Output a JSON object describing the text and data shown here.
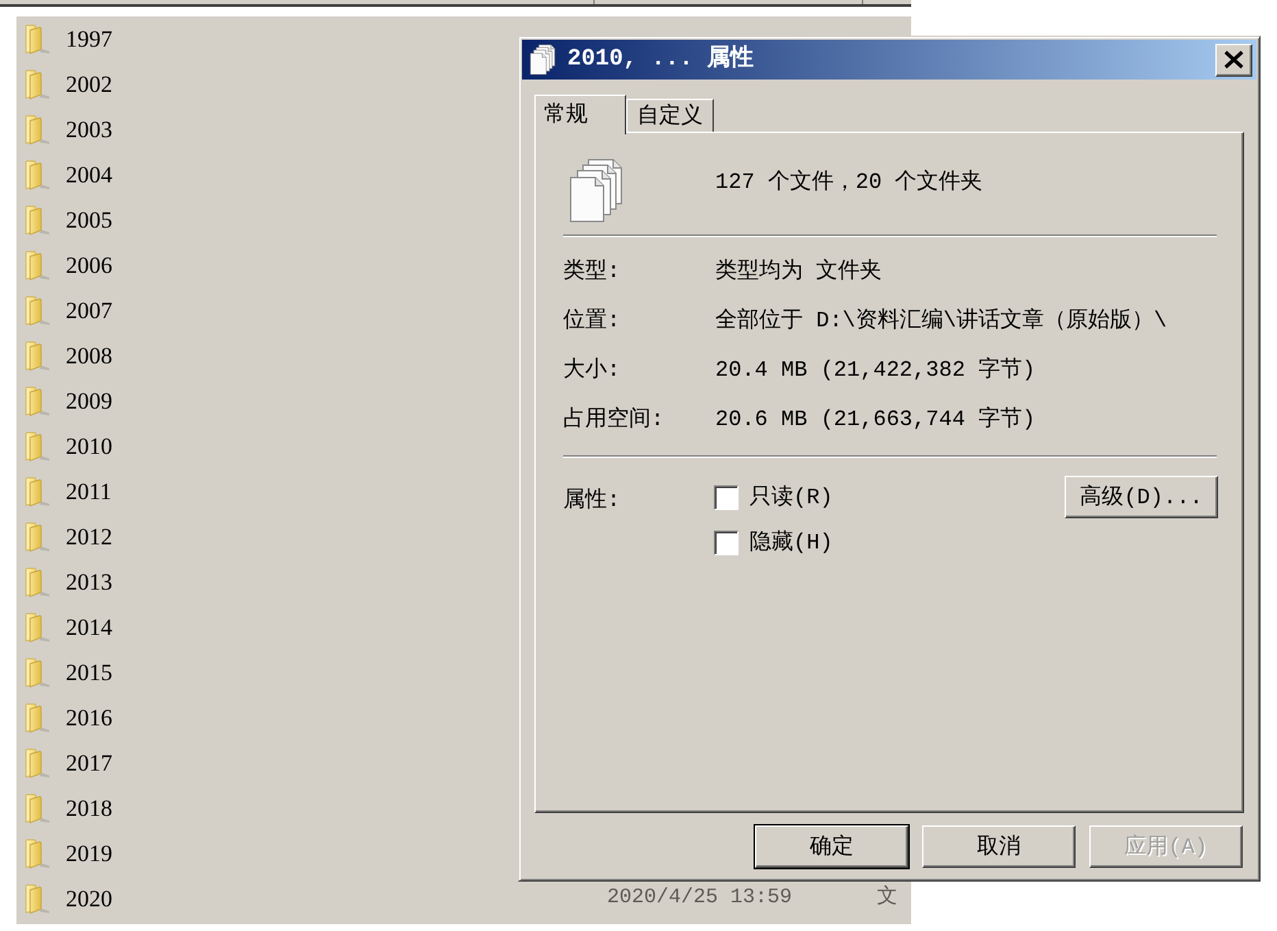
{
  "folders": [
    {
      "name": "1997"
    },
    {
      "name": "2002"
    },
    {
      "name": "2003"
    },
    {
      "name": "2004"
    },
    {
      "name": "2005"
    },
    {
      "name": "2006"
    },
    {
      "name": "2007"
    },
    {
      "name": "2008"
    },
    {
      "name": "2009"
    },
    {
      "name": "2010"
    },
    {
      "name": "2011"
    },
    {
      "name": "2012"
    },
    {
      "name": "2013"
    },
    {
      "name": "2014"
    },
    {
      "name": "2015"
    },
    {
      "name": "2016"
    },
    {
      "name": "2017"
    },
    {
      "name": "2018"
    },
    {
      "name": "2019"
    },
    {
      "name": "2020",
      "modified": "2020/4/25 13:59",
      "type": "文"
    }
  ],
  "dialog": {
    "title": "2010, ... 属性",
    "tabs": [
      {
        "label": "常规",
        "selected": true
      },
      {
        "label": "自定义",
        "selected": false
      }
    ],
    "summary": "127 个文件，20 个文件夹",
    "properties": [
      {
        "label": "类型:",
        "value": "类型均为 文件夹"
      },
      {
        "label": "位置:",
        "value": "全部位于 D:\\资料汇编\\讲话文章（原始版）\\"
      },
      {
        "label": "大小:",
        "value": "20.4 MB (21,422,382 字节)"
      },
      {
        "label": "占用空间:",
        "value": "20.6 MB (21,663,744 字节)"
      }
    ],
    "attributes_label": "属性:",
    "attributes": [
      {
        "label": "只读(R)",
        "checked": false
      },
      {
        "label": "隐藏(H)",
        "checked": false
      }
    ],
    "advanced_button": "高级(D)...",
    "buttons": [
      {
        "label": "确定",
        "default": true,
        "disabled": false
      },
      {
        "label": "取消",
        "default": false,
        "disabled": false
      },
      {
        "label": "应用(A)",
        "default": false,
        "disabled": true
      }
    ]
  }
}
